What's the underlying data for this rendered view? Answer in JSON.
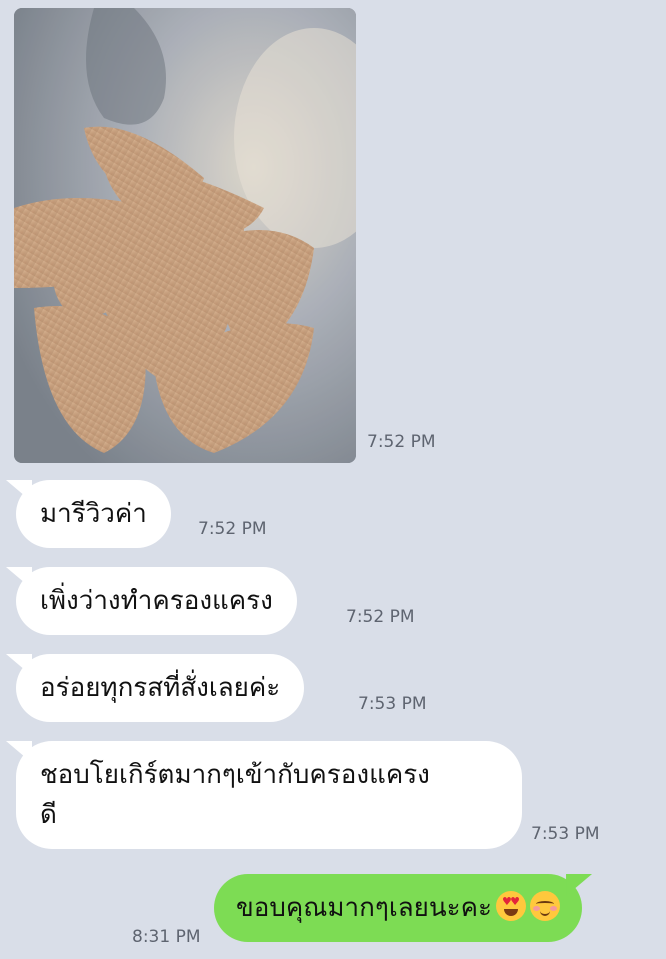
{
  "messages": [
    {
      "type": "image",
      "time": "7:52 PM"
    },
    {
      "type": "text",
      "text": "มารีวิวค่า",
      "time": "7:52 PM"
    },
    {
      "type": "text",
      "text": "เพิ่งว่างทำครองแครง",
      "time": "7:52 PM"
    },
    {
      "type": "text",
      "text": "อร่อยทุกรสที่สั่งเลยค่ะ",
      "time": "7:53 PM"
    },
    {
      "type": "text",
      "lines": [
        "ชอบโยเกิร์ตมากๆเข้ากับครองแครง",
        "ดี"
      ],
      "time": "7:53 PM"
    },
    {
      "type": "text",
      "outgoing": true,
      "text": "ขอบคุณมากๆเลยนะคะ",
      "emoji": [
        "smiling-face-with-heart-eyes-icon",
        "smiling-face-blushing-icon"
      ],
      "time": "8:31 PM"
    }
  ],
  "colors": {
    "background": "#d9dee8",
    "incoming_bubble": "#ffffff",
    "outgoing_bubble": "#7ddc54",
    "timestamp": "#5e6470"
  }
}
